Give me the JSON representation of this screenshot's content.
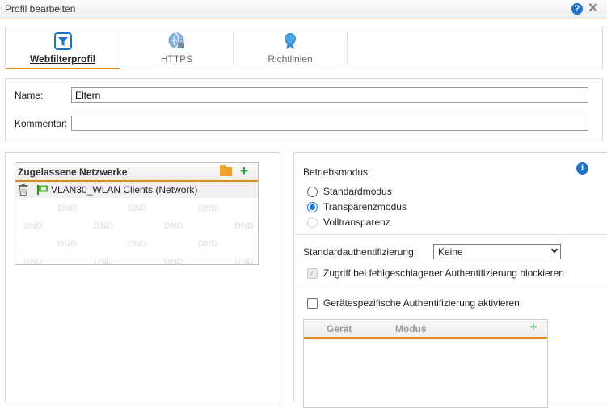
{
  "window": {
    "title": "Profil bearbeiten"
  },
  "tabs": [
    {
      "label": "Webfilterprofil",
      "active": true,
      "icon": "filter-icon"
    },
    {
      "label": "HTTPS",
      "active": false,
      "icon": "globe-lock-icon"
    },
    {
      "label": "Richtlinien",
      "active": false,
      "icon": "award-ribbon-icon"
    }
  ],
  "form": {
    "name_label": "Name:",
    "name_value": "Eltern",
    "comment_label": "Kommentar:",
    "comment_value": ""
  },
  "networks": {
    "header": "Zugelassene Netzwerke",
    "rows": [
      {
        "label": "VLAN30_WLAN Clients (Network)"
      }
    ],
    "dnd_text": "DND"
  },
  "mode": {
    "label": "Betriebsmodus:",
    "options": [
      {
        "label": "Standardmodus",
        "selected": false,
        "disabled": false
      },
      {
        "label": "Transparenzmodus",
        "selected": true,
        "disabled": false
      },
      {
        "label": "Volltransparenz",
        "selected": false,
        "disabled": true
      }
    ]
  },
  "auth": {
    "label": "Standardauthentifizierung:",
    "selected": "Keine",
    "block_label": "Zugriff bei fehlgeschlagener Authentifizierung blockieren",
    "block_checked": true,
    "block_disabled": true,
    "device_label": "Gerätespezifische Authentifizierung aktivieren",
    "device_checked": false
  },
  "device_table": {
    "columns": [
      "Gerät",
      "Modus"
    ]
  },
  "colors": {
    "accent": "#e08a1e",
    "link_blue": "#1e72c8",
    "add_green": "#2e9a2e"
  }
}
